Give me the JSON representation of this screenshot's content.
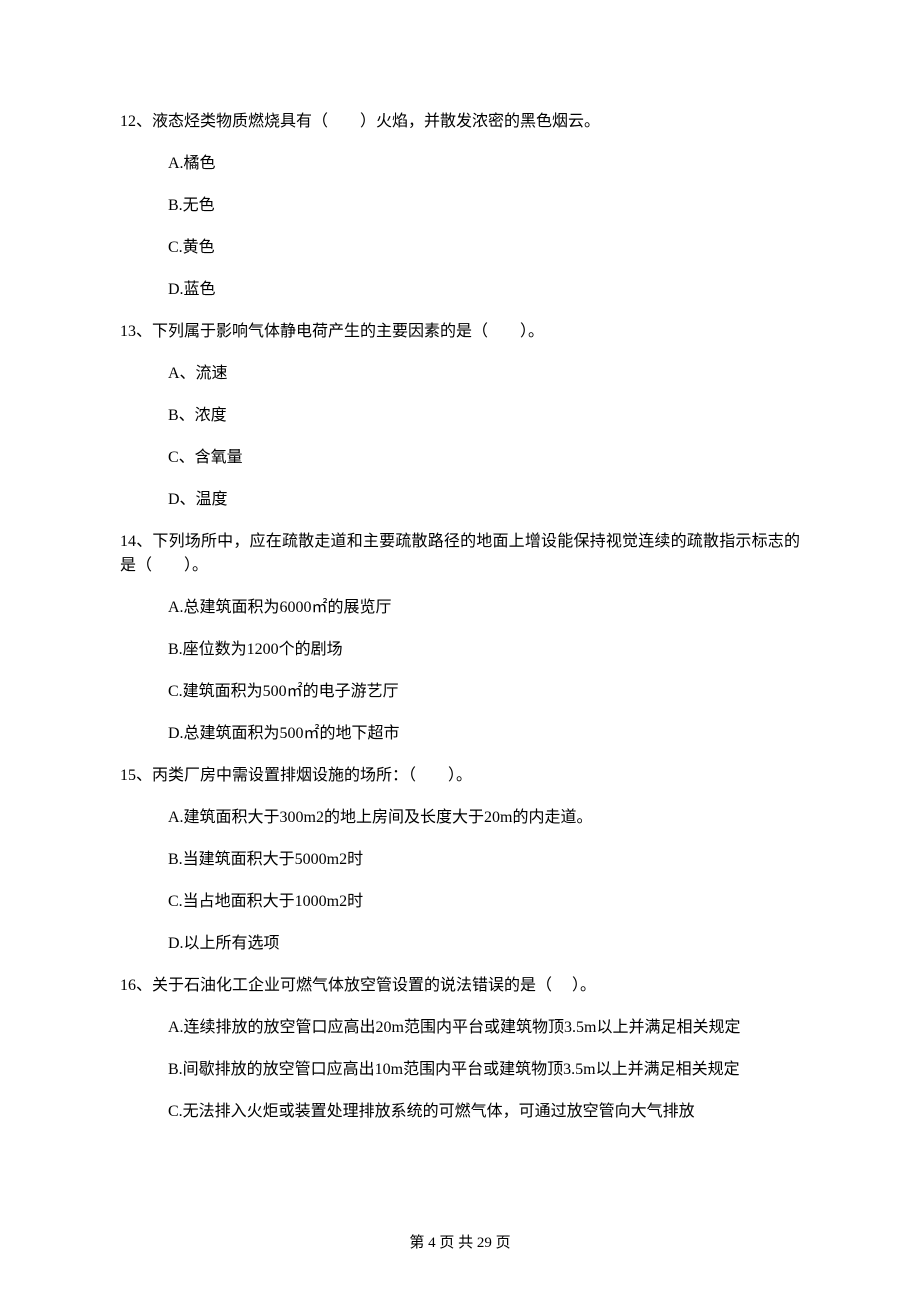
{
  "questions": [
    {
      "number": "12、",
      "text": "液态烃类物质燃烧具有（　　）火焰，并散发浓密的黑色烟云。",
      "options": [
        "A.橘色",
        "B.无色",
        "C.黄色",
        "D.蓝色"
      ]
    },
    {
      "number": "13、",
      "text": "下列属于影响气体静电荷产生的主要因素的是（　　）。",
      "options": [
        "A、流速",
        "B、浓度",
        "C、含氧量",
        "D、温度"
      ]
    },
    {
      "number": "14、",
      "text": "下列场所中，应在疏散走道和主要疏散路径的地面上增设能保持视觉连续的疏散指示标志的是（　　）。",
      "options": [
        "A.总建筑面积为6000㎡的展览厅",
        "B.座位数为1200个的剧场",
        "C.建筑面积为500㎡的电子游艺厅",
        "D.总建筑面积为500㎡的地下超市"
      ]
    },
    {
      "number": "15、",
      "text": "丙类厂房中需设置排烟设施的场所：（　　）。",
      "options": [
        "A.建筑面积大于300m2的地上房间及长度大于20m的内走道。",
        "B.当建筑面积大于5000m2时",
        "C.当占地面积大于1000m2时",
        "D.以上所有选项"
      ]
    },
    {
      "number": "16、",
      "text": "关于石油化工企业可燃气体放空管设置的说法错误的是（　 ）。",
      "options": [
        "A.连续排放的放空管口应高出20m范围内平台或建筑物顶3.5m以上并满足相关规定",
        "B.间歇排放的放空管口应高出10m范围内平台或建筑物顶3.5m以上并满足相关规定",
        "C.无法排入火炬或装置处理排放系统的可燃气体，可通过放空管向大气排放"
      ]
    }
  ],
  "footer": "第 4 页 共 29 页"
}
